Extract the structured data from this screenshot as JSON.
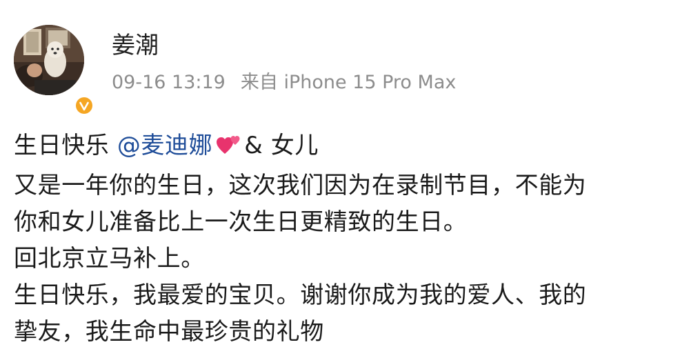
{
  "post": {
    "author": {
      "name": "姜潮",
      "avatar_icon": "profile-photo",
      "verified_icon": "verified-v-badge",
      "verified_color": "#f5a623"
    },
    "meta": {
      "time": "09-16 13:19",
      "source": "来自 iPhone 15 Pro Max"
    },
    "content": {
      "line1_prefix": "生日快乐 ",
      "mention": "@麦迪娜",
      "line1_emoji": "two-hearts-icon",
      "line1_suffix": "& 女儿",
      "line2": "又是一年你的生日，这次我们因为在录制节目，不能为",
      "line3": "你和女儿准备比上一次生日更精致的生日。",
      "line4": "回北京立马补上。",
      "line5": "生日快乐，我最爱的宝贝。谢谢你成为我的爱人、我的",
      "line6": "挚友，我生命中最珍贵的礼物"
    },
    "colors": {
      "text": "#1a1a1a",
      "mention": "#1f4d99",
      "meta": "#8c8c8c"
    }
  }
}
